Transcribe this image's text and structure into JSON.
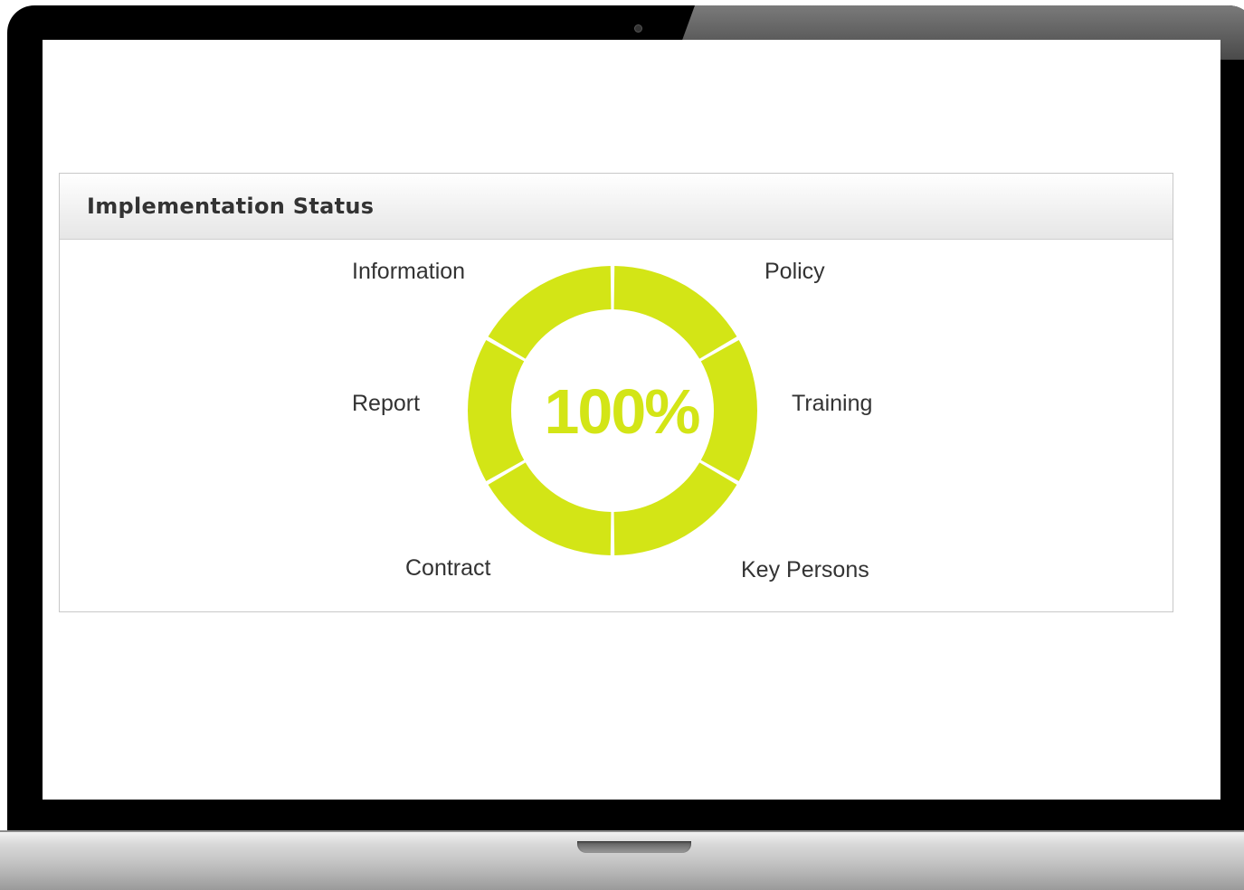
{
  "panel": {
    "title": "Implementation Status"
  },
  "status": {
    "percent_label": "100%",
    "percent_value": 100,
    "accent_color": "#d3e516"
  },
  "segments": [
    {
      "label": "Policy",
      "complete": 1.0
    },
    {
      "label": "Training",
      "complete": 1.0
    },
    {
      "label": "Key Persons",
      "complete": 1.0
    },
    {
      "label": "Contract",
      "complete": 1.0
    },
    {
      "label": "Report",
      "complete": 1.0
    },
    {
      "label": "Information",
      "complete": 1.0
    }
  ]
}
